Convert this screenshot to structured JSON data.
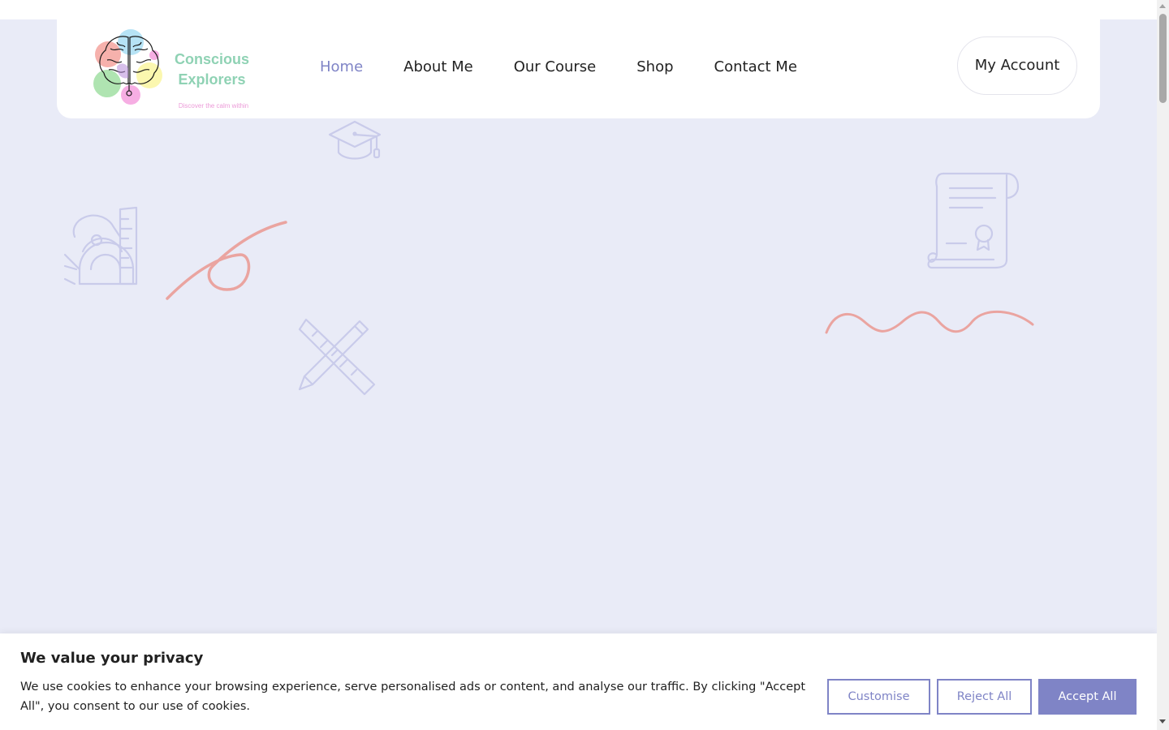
{
  "brand": {
    "name": "Conscious Explorers",
    "tagline": "Discover the calm within",
    "colors": {
      "name": "#8fd2b4",
      "tagline": "#ec9ad8",
      "accent": "#7f84c6",
      "hero_background": "#e9ebf7",
      "squiggle": "#eaa4a0"
    }
  },
  "nav": {
    "items": [
      {
        "label": "Home",
        "active": true
      },
      {
        "label": "About Me",
        "active": false
      },
      {
        "label": "Our Course",
        "active": false
      },
      {
        "label": "Shop",
        "active": false
      },
      {
        "label": "Contact Me",
        "active": false
      }
    ],
    "account_label": "My Account"
  },
  "hero": {
    "decorations": [
      "graduation-cap-icon",
      "geometry-tools-icon",
      "pencil-ruler-icon",
      "certificate-scroll-icon",
      "loop-squiggle",
      "wave-squiggle"
    ]
  },
  "cookie_banner": {
    "title": "We value your privacy",
    "text": "We use cookies to enhance your browsing experience, serve personalised ads or content, and analyse our traffic. By clicking \"Accept All\", you consent to our use of cookies.",
    "customise_label": "Customise",
    "reject_label": "Reject All",
    "accept_label": "Accept All"
  }
}
